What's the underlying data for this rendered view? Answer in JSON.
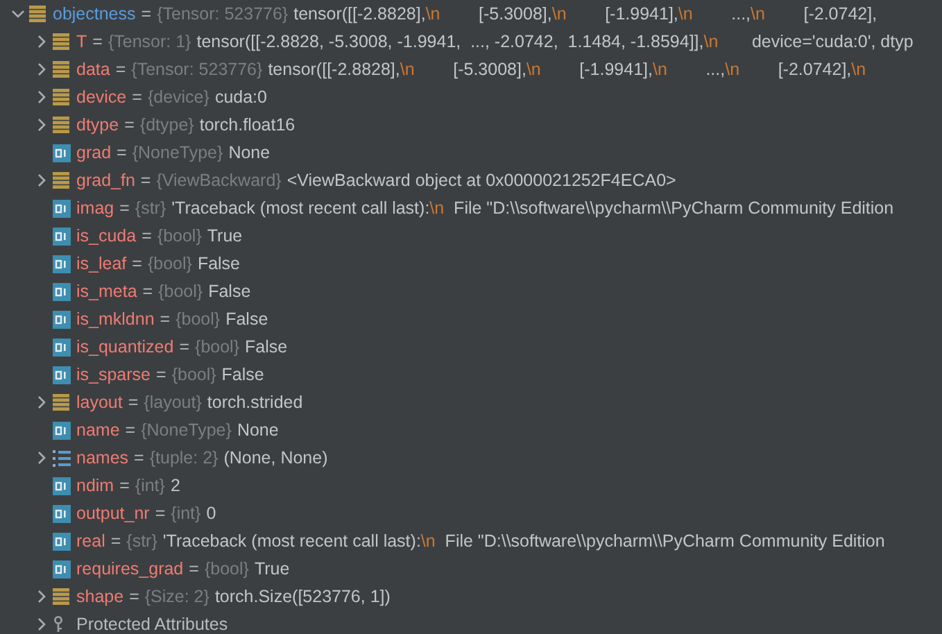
{
  "variables": [
    {
      "name": "objectness",
      "sep": "=",
      "type": "{Tensor: 523776}",
      "kind": "object",
      "expanded": true,
      "selected": true,
      "value_parts": [
        {
          "text": "tensor([[-2.8828],",
          "kind": "text"
        },
        {
          "text": "\\n",
          "kind": "escape"
        },
        {
          "text": "        [-5.3008],",
          "kind": "text"
        },
        {
          "text": "\\n",
          "kind": "escape"
        },
        {
          "text": "        [-1.9941],",
          "kind": "text"
        },
        {
          "text": "\\n",
          "kind": "escape"
        },
        {
          "text": "        ...,",
          "kind": "text"
        },
        {
          "text": "\\n",
          "kind": "escape"
        },
        {
          "text": "        [-2.0742],",
          "kind": "text"
        }
      ],
      "children": [
        {
          "name": "T",
          "sep": "=",
          "type": "{Tensor: 1}",
          "kind": "object",
          "expanded": false,
          "selected": false,
          "value_parts": [
            {
              "text": "tensor([[-2.8828, -5.3008, -1.9941,  ..., -2.0742,  1.1484, -1.8594]],",
              "kind": "text"
            },
            {
              "text": "\\n",
              "kind": "escape"
            },
            {
              "text": "       device='cuda:0', dtyp",
              "kind": "text"
            }
          ]
        },
        {
          "name": "data",
          "sep": "=",
          "type": "{Tensor: 523776}",
          "kind": "object",
          "expanded": false,
          "selected": false,
          "value_parts": [
            {
              "text": "tensor([[-2.8828],",
              "kind": "text"
            },
            {
              "text": "\\n",
              "kind": "escape"
            },
            {
              "text": "        [-5.3008],",
              "kind": "text"
            },
            {
              "text": "\\n",
              "kind": "escape"
            },
            {
              "text": "        [-1.9941],",
              "kind": "text"
            },
            {
              "text": "\\n",
              "kind": "escape"
            },
            {
              "text": "        ...,",
              "kind": "text"
            },
            {
              "text": "\\n",
              "kind": "escape"
            },
            {
              "text": "        [-2.0742],",
              "kind": "text"
            },
            {
              "text": "\\n",
              "kind": "escape"
            }
          ]
        },
        {
          "name": "device",
          "sep": "=",
          "type": "{device}",
          "kind": "object",
          "expanded": false,
          "selected": false,
          "value": "cuda:0"
        },
        {
          "name": "dtype",
          "sep": "=",
          "type": "{dtype}",
          "kind": "object",
          "expanded": false,
          "selected": false,
          "value": "torch.float16"
        },
        {
          "name": "grad",
          "sep": "=",
          "type": "{NoneType}",
          "kind": "primitive",
          "selected": false,
          "value": "None"
        },
        {
          "name": "grad_fn",
          "sep": "=",
          "type": "{ViewBackward}",
          "kind": "object",
          "expanded": false,
          "selected": false,
          "value": "<ViewBackward object at 0x0000021252F4ECA0>"
        },
        {
          "name": "imag",
          "sep": "=",
          "type": "{str}",
          "kind": "primitive",
          "selected": false,
          "value_parts": [
            {
              "text": "'Traceback (most recent call last):",
              "kind": "text"
            },
            {
              "text": "\\n",
              "kind": "escape"
            },
            {
              "text": "  File \"D:\\\\software\\\\pycharm\\\\PyCharm Community Edition",
              "kind": "text"
            }
          ]
        },
        {
          "name": "is_cuda",
          "sep": "=",
          "type": "{bool}",
          "kind": "primitive",
          "selected": false,
          "value": "True"
        },
        {
          "name": "is_leaf",
          "sep": "=",
          "type": "{bool}",
          "kind": "primitive",
          "selected": false,
          "value": "False"
        },
        {
          "name": "is_meta",
          "sep": "=",
          "type": "{bool}",
          "kind": "primitive",
          "selected": false,
          "value": "False"
        },
        {
          "name": "is_mkldnn",
          "sep": "=",
          "type": "{bool}",
          "kind": "primitive",
          "selected": false,
          "value": "False"
        },
        {
          "name": "is_quantized",
          "sep": "=",
          "type": "{bool}",
          "kind": "primitive",
          "selected": false,
          "value": "False"
        },
        {
          "name": "is_sparse",
          "sep": "=",
          "type": "{bool}",
          "kind": "primitive",
          "selected": false,
          "value": "False"
        },
        {
          "name": "layout",
          "sep": "=",
          "type": "{layout}",
          "kind": "object",
          "expanded": false,
          "selected": false,
          "value": "torch.strided"
        },
        {
          "name": "name",
          "sep": "=",
          "type": "{NoneType}",
          "kind": "primitive",
          "selected": false,
          "value": "None"
        },
        {
          "name": "names",
          "sep": "=",
          "type": "{tuple: 2}",
          "kind": "list",
          "expanded": false,
          "selected": false,
          "value": "(None, None)"
        },
        {
          "name": "ndim",
          "sep": "=",
          "type": "{int}",
          "kind": "primitive",
          "selected": false,
          "value": "2"
        },
        {
          "name": "output_nr",
          "sep": "=",
          "type": "{int}",
          "kind": "primitive",
          "selected": false,
          "value": "0"
        },
        {
          "name": "real",
          "sep": "=",
          "type": "{str}",
          "kind": "primitive",
          "selected": false,
          "value_parts": [
            {
              "text": "'Traceback (most recent call last):",
              "kind": "text"
            },
            {
              "text": "\\n",
              "kind": "escape"
            },
            {
              "text": "  File \"D:\\\\software\\\\pycharm\\\\PyCharm Community Edition",
              "kind": "text"
            }
          ]
        },
        {
          "name": "requires_grad",
          "sep": "=",
          "type": "{bool}",
          "kind": "primitive",
          "selected": false,
          "value": "True"
        },
        {
          "name": "shape",
          "sep": "=",
          "type": "{Size: 2}",
          "kind": "object",
          "expanded": false,
          "selected": false,
          "value": "torch.Size([523776, 1])"
        },
        {
          "name": "Protected Attributes",
          "kind": "group",
          "expanded": false,
          "selected": false
        }
      ]
    }
  ]
}
